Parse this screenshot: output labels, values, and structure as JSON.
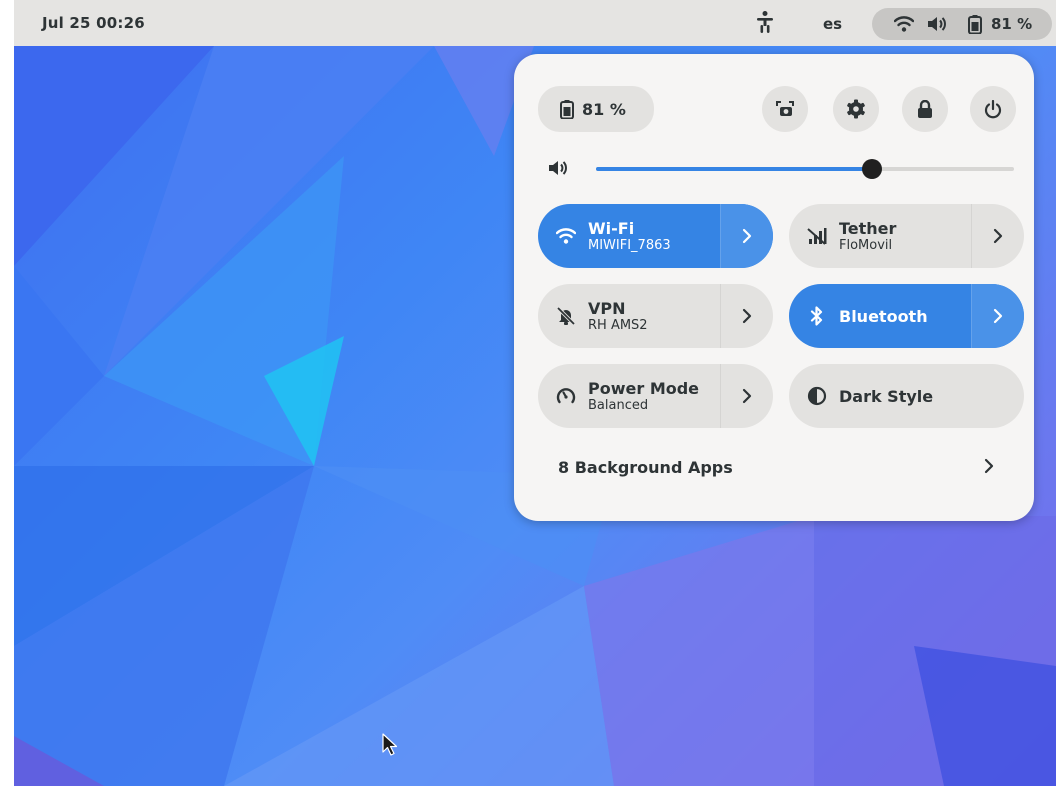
{
  "topbar": {
    "clock": "Jul 25  00:26",
    "language": "es",
    "battery_percent": "81 %",
    "icons": [
      "accessibility-icon",
      "wifi-icon",
      "volume-icon",
      "battery-icon"
    ]
  },
  "quick_settings": {
    "battery_label": "81 %",
    "header_buttons": [
      "screenshot-icon",
      "settings-icon",
      "lock-icon",
      "power-icon"
    ],
    "volume_level": 0.66,
    "tiles": [
      {
        "title": "Wi-Fi",
        "subtitle": "MIWIFI_7863",
        "active": true,
        "icon": "wifi-icon"
      },
      {
        "title": "Tether",
        "subtitle": "FloMovil",
        "active": false,
        "icon": "tether-icon"
      },
      {
        "title": "VPN",
        "subtitle": "RH AMS2",
        "active": false,
        "icon": "vpn-icon"
      },
      {
        "title": "Bluetooth",
        "subtitle": "",
        "active": true,
        "icon": "bluetooth-icon"
      },
      {
        "title": "Power Mode",
        "subtitle": "Balanced",
        "active": false,
        "icon": "power-mode-icon"
      },
      {
        "title": "Dark Style",
        "subtitle": "",
        "active": false,
        "icon": "dark-style-icon"
      }
    ],
    "background_apps": "8 Background Apps"
  },
  "colors": {
    "accent": "#3584e4",
    "panel": "#f6f5f4",
    "topbar": "#e5e4e2"
  }
}
